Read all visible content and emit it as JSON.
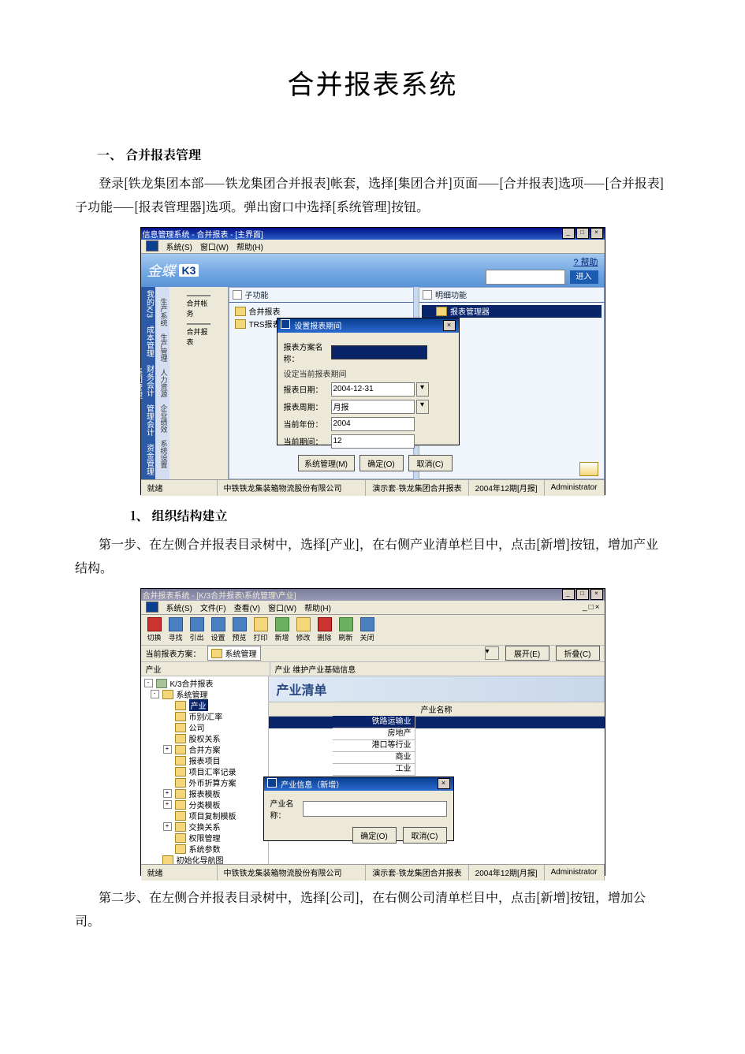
{
  "doc": {
    "title": "合并报表系统",
    "section1_heading": "一、 合并报表管理",
    "para1": "登录[铁龙集团本部——铁龙集团合并报表]帐套，选择[集团合并]页面——[合并报表]选项——[合并报表]子功能——[报表管理器]选项。弹出窗口中选择[系统管理]按钮。",
    "sub1_heading": "1、 组织结构建立",
    "para2": "第一步、在左侧合并报表目录树中，选择[产业]，在右侧产业清单栏目中，点击[新增]按钮，增加产业结构。",
    "para3": "第二步、在左侧合并报表目录树中，选择[公司]，在右侧公司清单栏目中，点击[新增]按钮，增加公司。"
  },
  "shot1": {
    "title": "信息管理系统 - 合并报表 - [主界面]",
    "menubar": [
      "系统(S)",
      "窗口(W)",
      "帮助(H)"
    ],
    "brand_text": "金蝶",
    "brand_k3": "K3",
    "help_link": "? 帮助",
    "go_btn": "进入",
    "nav_strip": "我的K/3　成本管理　财务会计　管理会计　资金管理　集团管理",
    "nav2": "生产系统　生产管理　人力资源　企业绩效　系统设置",
    "side": {
      "icon1": "合并帐务",
      "icon2": "合并报表"
    },
    "col_left_head": "子功能",
    "col_right_head": "明细功能",
    "tree_left": [
      "合并报表",
      "TRS报表查看"
    ],
    "tree_right": [
      "报表管理器"
    ],
    "dialog": {
      "title": "设置报表期间",
      "row_plan": "报表方案名称：",
      "section": "设定当前报表期间",
      "row_date": "报表日期：",
      "row_date_val": "2004-12-31",
      "row_cycle": "报表周期：",
      "row_cycle_val": "月报",
      "row_year": "当前年份：",
      "row_year_val": "2004",
      "row_period": "当前期间：",
      "row_period_val": "12",
      "btn_sys": "系统管理(M)",
      "btn_ok": "确定(O)",
      "btn_cancel": "取消(C)"
    },
    "status": {
      "s1": "就绪",
      "s2": "中铁铁龙集装箱物流股份有限公司",
      "s3": "演示套·铁龙集团合并报表",
      "s4": "2004年12期[月报]",
      "s5": "Administrator"
    }
  },
  "shot2": {
    "title": "合并报表系统 - [K/3合并报表\\系统管理\\产业]",
    "menubar": [
      "系统(S)",
      "文件(F)",
      "查看(V)",
      "窗口(W)",
      "帮助(H)"
    ],
    "toolbar": [
      {
        "l": "切换",
        "c": "red"
      },
      {
        "l": "寻找",
        "c": "blue"
      },
      {
        "l": "引出",
        "c": "blue"
      },
      {
        "l": "设置",
        "c": "blue"
      },
      {
        "l": "预览",
        "c": "blue"
      },
      {
        "l": "打印",
        "c": "yellow"
      },
      {
        "l": "新增",
        "c": "green"
      },
      {
        "l": "修改",
        "c": "yellow"
      },
      {
        "l": "删除",
        "c": "red"
      },
      {
        "l": "刷新",
        "c": "green"
      },
      {
        "l": "关闭",
        "c": "blue"
      }
    ],
    "planbar": {
      "label": "当前报表方案：",
      "folder": "系统管理",
      "btn_expand": "展开(E)",
      "btn_collapse": "折叠(C)"
    },
    "workhead_left": "产业",
    "workhead_right": "产业  维护产业基础信息",
    "tree": [
      {
        "d": 0,
        "exp": "-",
        "c": "g",
        "t": "K/3合并报表"
      },
      {
        "d": 1,
        "exp": "-",
        "c": "y",
        "t": "系统管理"
      },
      {
        "d": 2,
        "exp": "",
        "c": "y",
        "t": "产业",
        "sel": true
      },
      {
        "d": 2,
        "exp": "",
        "c": "y",
        "t": "币别/汇率"
      },
      {
        "d": 2,
        "exp": "",
        "c": "y",
        "t": "公司"
      },
      {
        "d": 2,
        "exp": "",
        "c": "y",
        "t": "股权关系"
      },
      {
        "d": 2,
        "exp": "+",
        "c": "y",
        "t": "合并方案"
      },
      {
        "d": 2,
        "exp": "",
        "c": "y",
        "t": "报表项目"
      },
      {
        "d": 2,
        "exp": "",
        "c": "y",
        "t": "项目汇率记录"
      },
      {
        "d": 2,
        "exp": "",
        "c": "y",
        "t": "外币折算方案"
      },
      {
        "d": 2,
        "exp": "+",
        "c": "y",
        "t": "报表模板"
      },
      {
        "d": 2,
        "exp": "+",
        "c": "y",
        "t": "分类模板"
      },
      {
        "d": 2,
        "exp": "",
        "c": "y",
        "t": "项目复制模板"
      },
      {
        "d": 2,
        "exp": "+",
        "c": "y",
        "t": "交换关系"
      },
      {
        "d": 2,
        "exp": "",
        "c": "y",
        "t": "权限管理"
      },
      {
        "d": 2,
        "exp": "",
        "c": "y",
        "t": "系统参数"
      },
      {
        "d": 1,
        "exp": "",
        "c": "y",
        "t": "初始化导航图"
      }
    ],
    "banner": "产业清单",
    "list_header": "产业名称",
    "rows": [
      "铁路运输业",
      "房地产",
      "港口等行业",
      "商业",
      "工业"
    ],
    "dialog": {
      "title": "产业信息（新增）",
      "label": "产业名称：",
      "btn_ok": "确定(O)",
      "btn_cancel": "取消(C)"
    },
    "status": {
      "s1": "就绪",
      "s2": "中铁铁龙集装箱物流股份有限公司",
      "s3": "演示套·铁龙集团合并报表",
      "s4": "2004年12期[月报]",
      "s5": "Administrator"
    }
  }
}
